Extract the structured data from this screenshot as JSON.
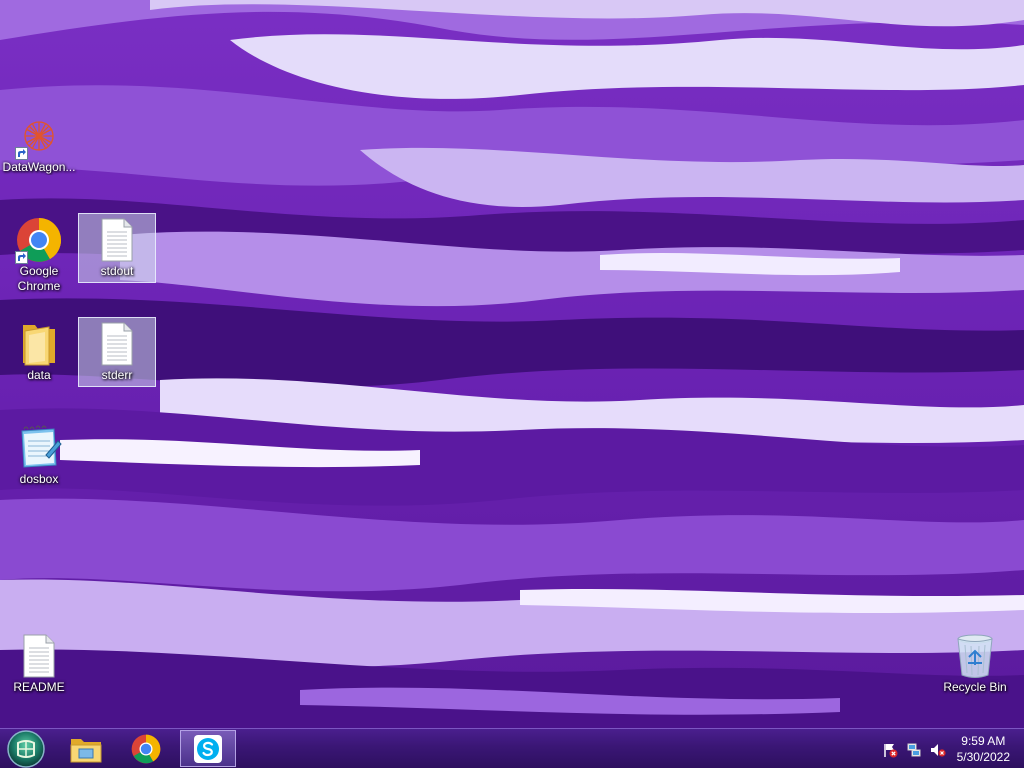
{
  "desktop": {
    "icons": [
      {
        "id": "datawagon",
        "label": "DataWagon..."
      },
      {
        "id": "chrome",
        "label": "Google Chrome"
      },
      {
        "id": "stdout",
        "label": "stdout"
      },
      {
        "id": "data",
        "label": "data"
      },
      {
        "id": "stderr",
        "label": "stderr"
      },
      {
        "id": "dosbox",
        "label": "dosbox"
      },
      {
        "id": "readme",
        "label": "README"
      },
      {
        "id": "recycle",
        "label": "Recycle Bin"
      }
    ]
  },
  "taskbar": {
    "pinned": [
      {
        "name": "file-explorer",
        "icon": "folder-icon"
      },
      {
        "name": "chrome",
        "icon": "chrome-icon"
      },
      {
        "name": "skype",
        "icon": "skype-icon",
        "active": true
      }
    ],
    "tray": {
      "icons": [
        "action-center-flag-icon",
        "network-icon",
        "speaker-muted-icon"
      ]
    },
    "clock": {
      "time": "9:59 AM",
      "date": "5/30/2022"
    }
  },
  "colors": {
    "wallpaper_base": "#6f2ab8",
    "taskbar": "#3a1675",
    "selection": "#cdd7eb"
  }
}
